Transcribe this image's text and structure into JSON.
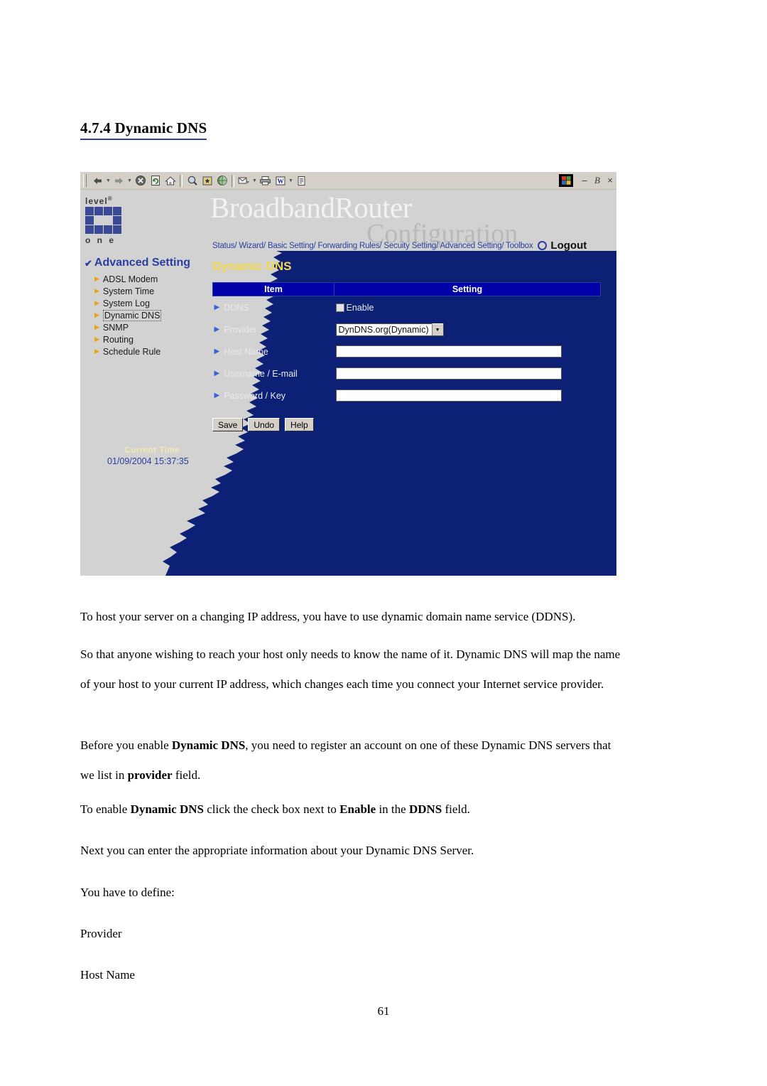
{
  "document": {
    "heading": "4.7.4 Dynamic DNS",
    "page_number": "61",
    "paragraphs": [
      {
        "id": "p1",
        "runs": [
          {
            "text": "To host your server on a changing IP address, you have to use dynamic domain name service (DDNS).",
            "bold": false
          }
        ]
      },
      {
        "id": "p2",
        "runs": [
          {
            "text": "So that anyone wishing to reach your host only needs to know the name of it. Dynamic DNS will map the name of your host to your current IP address, which changes each time you connect your Internet service provider.",
            "bold": false
          }
        ]
      },
      {
        "id": "p3",
        "runs": [
          {
            "text": "Before you enable ",
            "bold": false
          },
          {
            "text": "Dynamic DNS",
            "bold": true
          },
          {
            "text": ", you need to register an account on one of these Dynamic DNS servers that we list in ",
            "bold": false
          },
          {
            "text": "provider",
            "bold": true
          },
          {
            "text": " field.",
            "bold": false
          }
        ]
      },
      {
        "id": "p4",
        "runs": [
          {
            "text": "To enable ",
            "bold": false
          },
          {
            "text": "Dynamic DNS",
            "bold": true
          },
          {
            "text": " click the check box next to ",
            "bold": false
          },
          {
            "text": "Enable",
            "bold": true
          },
          {
            "text": " in the ",
            "bold": false
          },
          {
            "text": "DDNS",
            "bold": true
          },
          {
            "text": " field.",
            "bold": false
          }
        ]
      },
      {
        "id": "p5",
        "runs": [
          {
            "text": "Next you can enter the appropriate information about your Dynamic DNS Server.",
            "bold": false
          }
        ]
      },
      {
        "id": "p6",
        "runs": [
          {
            "text": "You have to define:",
            "bold": false
          }
        ]
      },
      {
        "id": "p7",
        "runs": [
          {
            "text": "Provider",
            "bold": false
          }
        ]
      },
      {
        "id": "p8",
        "runs": [
          {
            "text": "Host Name",
            "bold": false
          }
        ]
      }
    ]
  },
  "browser": {
    "toolbar": {
      "buttons": [
        {
          "name": "back-icon",
          "glyph": "⇦"
        },
        {
          "name": "back-dropdown-icon",
          "glyph": "▾"
        },
        {
          "name": "forward-icon",
          "glyph": "⇨"
        },
        {
          "name": "forward-dropdown-icon",
          "glyph": "▾"
        },
        {
          "name": "stop-icon",
          "glyph": "⊗"
        },
        {
          "name": "refresh-icon",
          "glyph": "↻"
        },
        {
          "name": "home-icon",
          "glyph": "⌂"
        },
        {
          "name": "search-icon",
          "glyph": "⌕"
        },
        {
          "name": "favorites-icon",
          "glyph": "★"
        },
        {
          "name": "history-icon",
          "glyph": "◔"
        },
        {
          "name": "mail-icon",
          "glyph": "✉"
        },
        {
          "name": "mail-dropdown-icon",
          "glyph": "▾"
        },
        {
          "name": "print-icon",
          "glyph": "⎙"
        },
        {
          "name": "edit-word-icon",
          "glyph": "W"
        },
        {
          "name": "edit-dropdown-icon",
          "glyph": "▾"
        },
        {
          "name": "discuss-icon",
          "glyph": "▤"
        }
      ]
    },
    "window_controls": {
      "logo": "windows-logo",
      "minimize": "–",
      "restore": "В",
      "close": "×"
    }
  },
  "router_ui": {
    "logo": {
      "top": "level",
      "sup": "®",
      "bottom": "o n e"
    },
    "brand": "BroadbandRouter",
    "brand_watermark": "Configuration",
    "nav": "Status/ Wizard/ Basic Setting/ Forwarding Rules/ Secuity Setting/ Advanced Setting/ Toolbox",
    "logout_label": "Logout",
    "sidebar": {
      "section_title": "Advanced Setting",
      "items": [
        {
          "label": "ADSL Modem",
          "selected": false
        },
        {
          "label": "System Time",
          "selected": false
        },
        {
          "label": "System Log",
          "selected": false
        },
        {
          "label": "Dynamic DNS",
          "selected": true
        },
        {
          "label": "SNMP",
          "selected": false
        },
        {
          "label": "Routing",
          "selected": false
        },
        {
          "label": "Schedule Rule",
          "selected": false
        }
      ],
      "current_time_label": "Current Time",
      "current_time_value": "01/09/2004 15:37:35"
    },
    "form": {
      "title": "Dynamic DNS",
      "columns": {
        "item": "Item",
        "setting": "Setting"
      },
      "rows": [
        {
          "item": "DDNS",
          "control": "checkbox",
          "checkbox_label": "Enable",
          "checked": false
        },
        {
          "item": "Provider",
          "control": "select",
          "value": "DynDNS.org(Dynamic)"
        },
        {
          "item": "Host Name",
          "control": "text",
          "value": ""
        },
        {
          "item": "Username / E-mail",
          "control": "text",
          "value": ""
        },
        {
          "item": "Password / Key",
          "control": "text",
          "value": ""
        }
      ],
      "buttons": [
        {
          "label": "Save",
          "name": "save-button"
        },
        {
          "label": "Undo",
          "name": "undo-button"
        },
        {
          "label": "Help",
          "name": "help-button"
        }
      ]
    }
  },
  "colors": {
    "panel_blue": "#0c2175",
    "header_blue": "#0000a8",
    "title_yellow": "#f5d949",
    "nav_blue": "#2b3ea0",
    "sidebar_gray": "#d2d2d2",
    "toolbar_gray": "#d4d0c8"
  }
}
